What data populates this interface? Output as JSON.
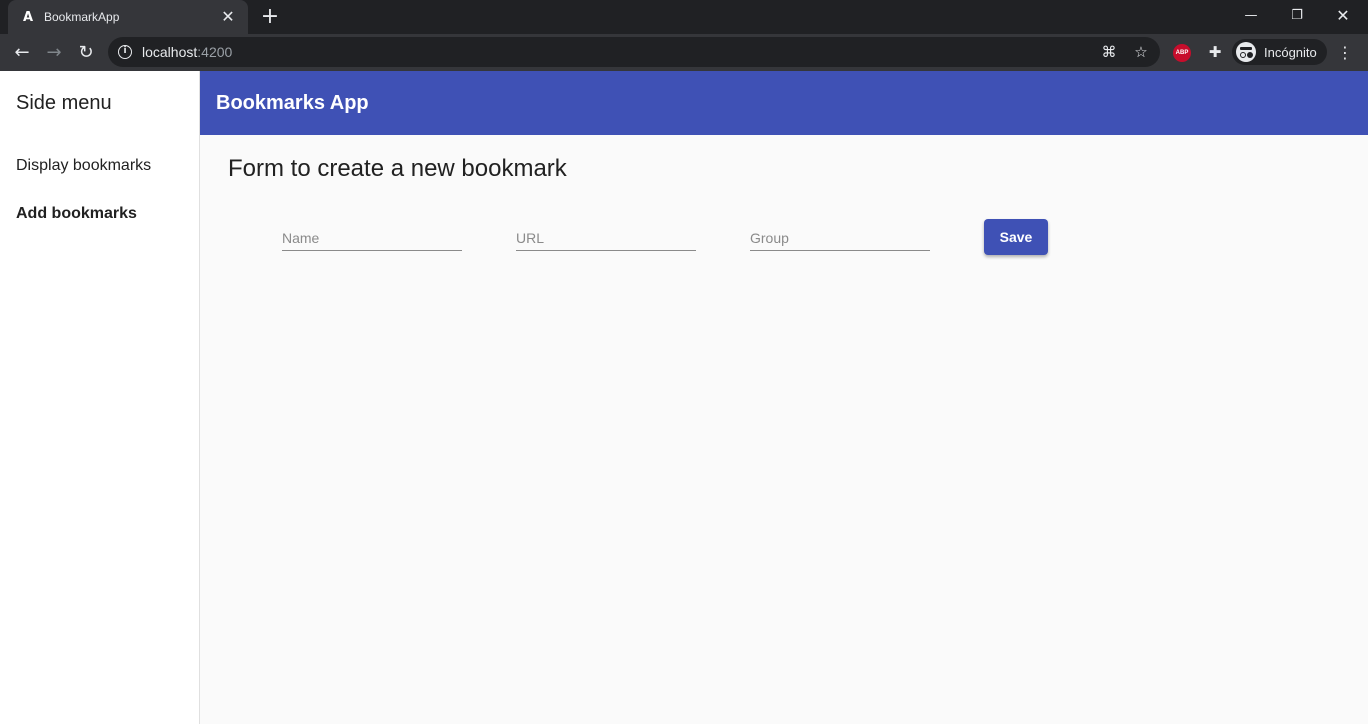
{
  "browser": {
    "tab_title": "BookmarkApp",
    "tab_favicon": "A",
    "url_host": "localhost",
    "url_port": ":4200",
    "profile_label": "Incógnito",
    "extension_abp_label": "ABP"
  },
  "sidebar": {
    "title": "Side menu",
    "items": [
      {
        "label": "Display bookmarks",
        "active": false
      },
      {
        "label": "Add bookmarks",
        "active": true
      }
    ]
  },
  "header": {
    "title": "Bookmarks App",
    "color": "#3f51b5"
  },
  "main": {
    "heading": "Form to create a new bookmark",
    "fields": [
      {
        "name": "name",
        "placeholder": "Name",
        "value": ""
      },
      {
        "name": "url",
        "placeholder": "URL",
        "value": ""
      },
      {
        "name": "group",
        "placeholder": "Group",
        "value": ""
      }
    ],
    "save_label": "Save"
  },
  "icons": {
    "back": "arrow-left",
    "forward": "arrow-right",
    "reload": "reload",
    "site_info": "info",
    "translate": "translate",
    "bookmark_star": "star",
    "extensions": "puzzle",
    "menu": "more-vertical"
  }
}
